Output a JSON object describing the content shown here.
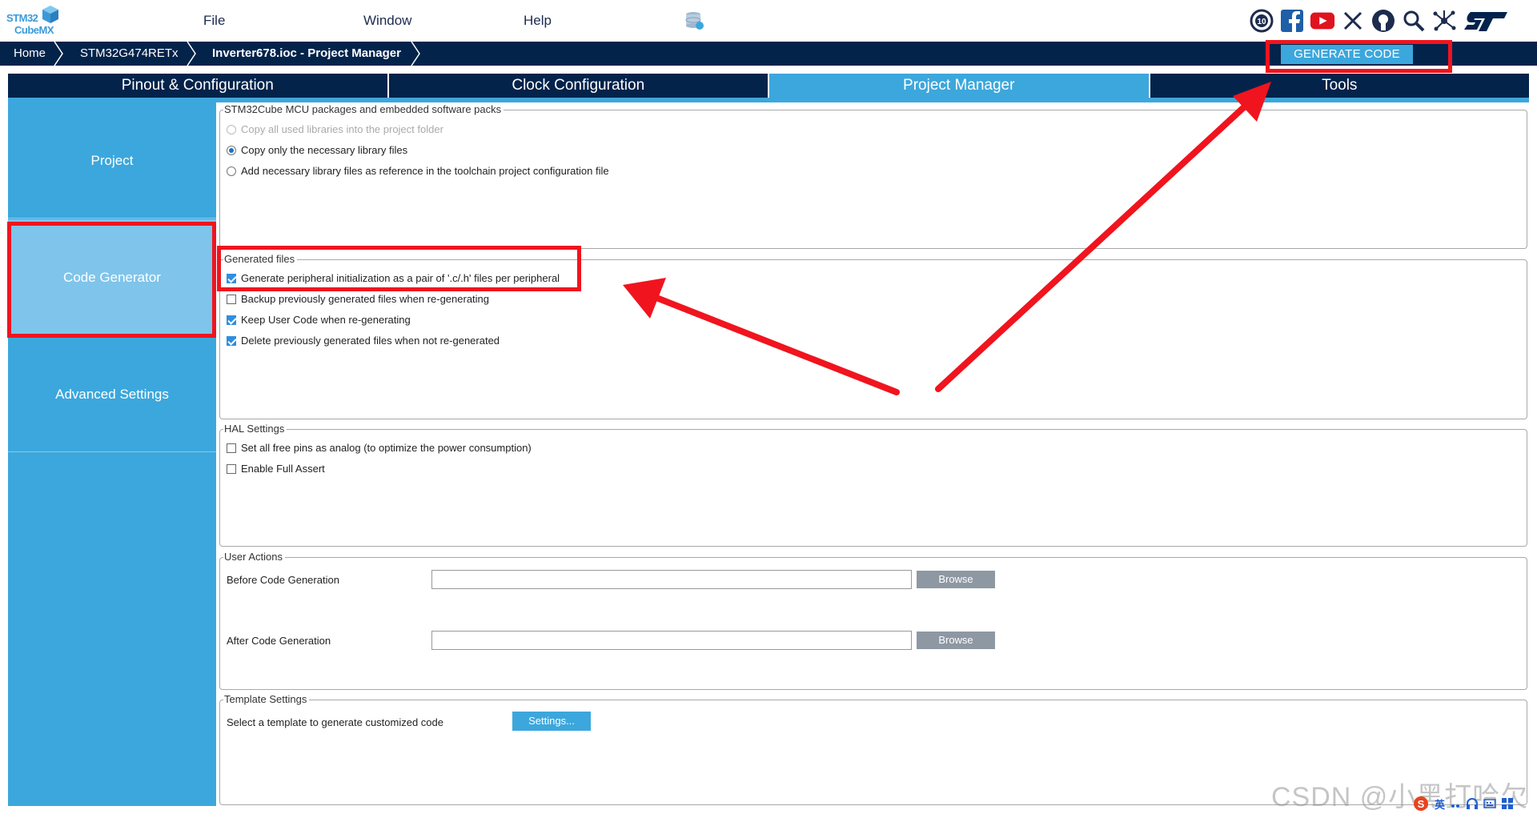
{
  "app": {
    "logo_line1": "STM32",
    "logo_line2": "CubeMX",
    "menu": [
      "File",
      "Window",
      "Help"
    ]
  },
  "social_icons": [
    "anniversary-10-icon",
    "facebook-icon",
    "youtube-icon",
    "x-icon",
    "github-icon",
    "search-web-icon",
    "network-icon",
    "st-logo-icon"
  ],
  "breadcrumb": {
    "home": "Home",
    "device": "STM32G474RETx",
    "project": "Inverter678.ioc - Project Manager"
  },
  "generate_button": "GENERATE CODE",
  "tabs": {
    "pinout": "Pinout & Configuration",
    "clock": "Clock Configuration",
    "project_manager": "Project Manager",
    "tools": "Tools"
  },
  "sidebar": {
    "project": "Project",
    "code_generator": "Code Generator",
    "advanced": "Advanced Settings"
  },
  "packages": {
    "title": "STM32Cube MCU packages and embedded software packs",
    "opt1": "Copy all used libraries into the project folder",
    "opt2": "Copy only the necessary library files",
    "opt3": "Add necessary library files as reference in the toolchain project configuration file",
    "selected": "Copy only the necessary library files"
  },
  "generated_files": {
    "title": "Generated files",
    "opt1": "Generate peripheral initialization as a pair of '.c/.h' files per peripheral",
    "opt2": "Backup previously generated files when re-generating",
    "opt3": "Keep User Code when re-generating",
    "opt4": "Delete previously generated files when not re-generated",
    "checked": [
      true,
      false,
      true,
      true
    ]
  },
  "hal": {
    "title": "HAL Settings",
    "opt1": "Set all free pins as analog (to optimize the power consumption)",
    "opt2": "Enable Full Assert",
    "checked": [
      false,
      false
    ]
  },
  "user_actions": {
    "title": "User Actions",
    "before_label": "Before Code Generation",
    "after_label": "After Code Generation",
    "before_value": "",
    "after_value": "",
    "browse": "Browse"
  },
  "template": {
    "title": "Template Settings",
    "label": "Select a template to generate customized code",
    "button": "Settings..."
  },
  "watermark": "CSDN @小黑打哈欠",
  "ime": {
    "lang": "英"
  },
  "colors": {
    "navy": "#03234b",
    "accent": "#3ca7dc",
    "active_side": "#7fc4ea",
    "annotation_red": "#f0141e"
  }
}
